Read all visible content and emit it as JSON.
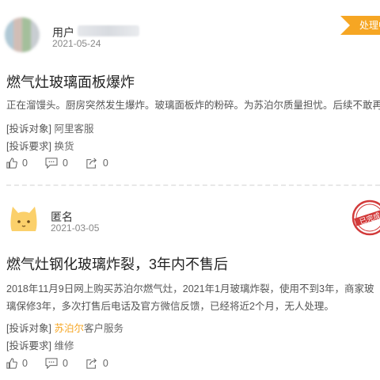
{
  "complaints": [
    {
      "username": "用户",
      "date": "2021-05-24",
      "status": "处理中",
      "title": "燃气灶玻璃面板爆炸",
      "content": "正在溜馒头。厨房突然发生爆炸。玻璃面板炸的粉碎。为苏泊尔质量担忧。后续不敢再用玻璃面板",
      "target_label": "[投诉对象]",
      "target_value": "阿里客服",
      "request_label": "[投诉要求]",
      "request_value": "换货",
      "likes": "0",
      "comments": "0",
      "shares": "0"
    },
    {
      "username": "匿名",
      "date": "2021-03-05",
      "status": "已完成",
      "title": "燃气灶钢化玻璃炸裂，3年内不售后",
      "content": "2018年11月9日网上购买苏泊尔燃气灶，2021年1月玻璃炸裂，使用不到3年，商家玻璃保修3年，多次打售后电话及官方微信反馈，已经将近2个月，无人处理。",
      "target_label": "[投诉对象]",
      "target_brand": "苏泊尔",
      "target_value": "客户服务",
      "request_label": "[投诉要求]",
      "request_value": "维修",
      "likes": "0",
      "comments": "0",
      "shares": "0"
    }
  ],
  "colors": {
    "accent": "#f6a623",
    "seal": "#d23a3a",
    "text": "#333333",
    "muted": "#888888"
  },
  "icons": {
    "like": "thumbs-up-icon",
    "comment": "comment-icon",
    "share": "share-icon"
  }
}
